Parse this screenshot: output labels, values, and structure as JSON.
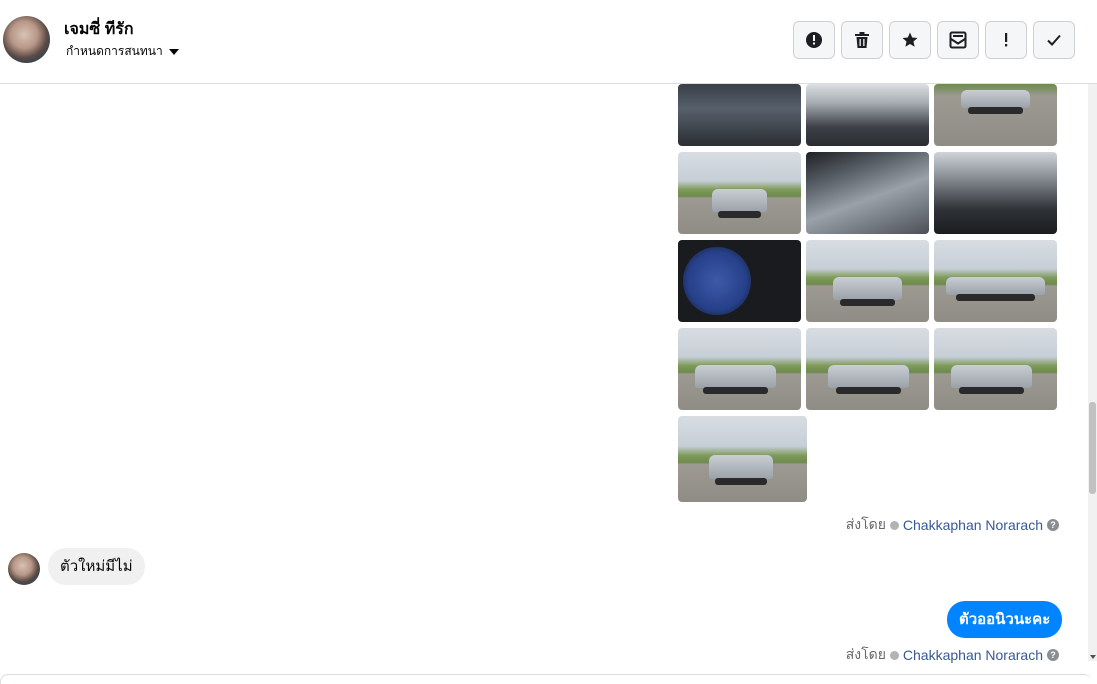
{
  "header": {
    "contact_name": "เจมซี่ ทีรัก",
    "customize_label": "กำหนดการสนทนา",
    "actions": [
      {
        "icon": "alert-circle-icon",
        "name": "report-button"
      },
      {
        "icon": "trash-icon",
        "name": "delete-button"
      },
      {
        "icon": "star-icon",
        "name": "star-button"
      },
      {
        "icon": "mail-archive-icon",
        "name": "mark-unread-button"
      },
      {
        "icon": "exclamation-icon",
        "name": "spam-button"
      },
      {
        "icon": "checkmark-icon",
        "name": "done-button"
      }
    ]
  },
  "messages": {
    "sent_by_label": "ส่งโดย",
    "sender_name": "Chakkaphan Norarach",
    "help_glyph": "?",
    "incoming_text": "ตัวใหม่มีไม่",
    "outgoing_text": "ตัวออนิวนะคะ"
  },
  "colors": {
    "outgoing_bubble": "#0084ff",
    "incoming_bubble": "#f0f0f0",
    "link": "#385898"
  }
}
